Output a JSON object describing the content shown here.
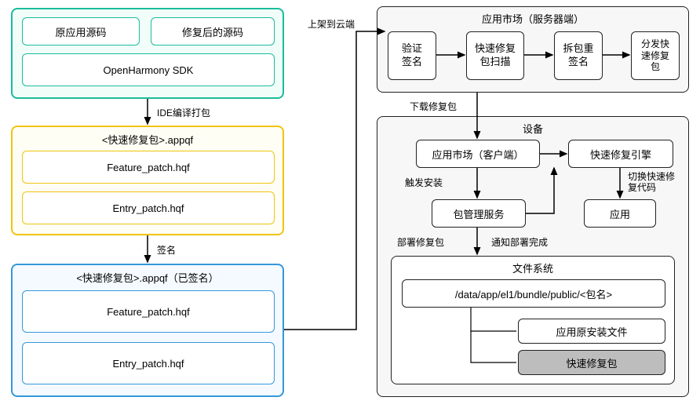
{
  "left": {
    "source_panel": {
      "orig_source": "原应用源码",
      "fixed_source": "修复后的源码",
      "sdk": "OpenHarmony SDK"
    },
    "arrow1_label": "IDE编译打包",
    "appqf_panel": {
      "title": "<快速修复包>.appqf",
      "feature": "Feature_patch.hqf",
      "entry": "Entry_patch.hqf"
    },
    "arrow2_label": "签名",
    "signed_panel": {
      "title": "<快速修复包>.appqf（已签名）",
      "feature": "Feature_patch.hqf",
      "entry": "Entry_patch.hqf"
    }
  },
  "upload_label": "上架到云端",
  "server_panel": {
    "title": "应用市场（服务器端）",
    "verify_sig": "验证\n签名",
    "scan": "快速修复\n包扫描",
    "resign": "拆包重\n签名",
    "distribute": "分发快\n速修复\n包"
  },
  "download_label": "下载修复包",
  "device_panel": {
    "title": "设备",
    "market_client": "应用市场（客户端）",
    "qf_engine": "快速修复引擎",
    "trigger_install": "触发安装",
    "switch_code": "切换快速修\n复代码",
    "pkg_service": "包管理服务",
    "app": "应用",
    "deploy_label": "部署修复包",
    "notify_label": "通知部署完成",
    "fs_panel": {
      "title": "文件系统",
      "path": "/data/app/el1/bundle/public/<包名>",
      "orig_files": "应用原安装文件",
      "qf_pkg": "快速修复包"
    }
  }
}
